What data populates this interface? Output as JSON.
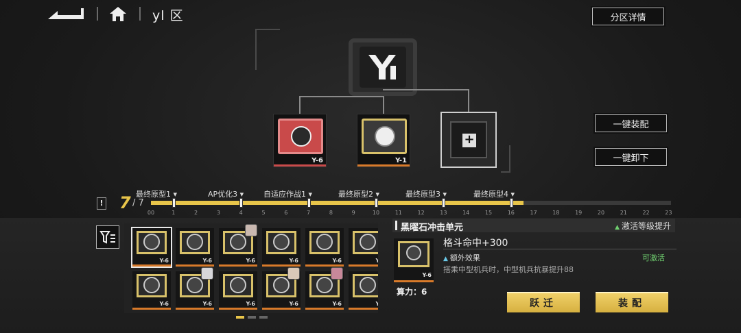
{
  "header": {
    "zone_title": "yl 区",
    "zone_detail_label": "分区详情"
  },
  "hub": {
    "logo_icon": "yl-logo-icon"
  },
  "slots": [
    {
      "label": "Y-6",
      "accent": "#c94a4a"
    },
    {
      "label": "Y-1",
      "accent": "#d8c16a"
    },
    {
      "label": "",
      "empty": true
    }
  ],
  "actions": {
    "equip_all": "一键装配",
    "unequip_all": "一键卸下"
  },
  "timeline": {
    "level": "7",
    "max": "/ 7",
    "milestones": [
      "最终原型1",
      "AP优化3",
      "自适应作战1",
      "最终原型2",
      "最终原型3",
      "最终原型4"
    ],
    "ticks": [
      "00",
      "1",
      "2",
      "3",
      "4",
      "5",
      "6",
      "7",
      "8",
      "9",
      "10",
      "11",
      "12",
      "13",
      "14",
      "15",
      "16",
      "17",
      "18",
      "19",
      "20",
      "21",
      "22",
      "23"
    ],
    "progress": 0.717
  },
  "inventory": {
    "items": [
      {
        "label": "Y-6",
        "sym": "x"
      },
      {
        "label": "Y-6",
        "sym": "x"
      },
      {
        "label": "Y-6",
        "sym": "swirl"
      },
      {
        "label": "Y-6",
        "sym": "x"
      },
      {
        "label": "Y-6",
        "sym": "swirl"
      },
      {
        "label": "Y-6",
        "sym": "x"
      },
      {
        "label": "Y-6",
        "sym": "x"
      },
      {
        "label": "Y-6",
        "sym": "x"
      },
      {
        "label": "Y-6",
        "sym": "swirl"
      },
      {
        "label": "Y-6",
        "sym": "x"
      },
      {
        "label": "Y-6",
        "sym": "swirl"
      },
      {
        "label": "Y-6",
        "sym": "x"
      }
    ]
  },
  "detail": {
    "title": "黑曜石冲击单元",
    "upgrade": "激活等级提升",
    "stat": "格斗命中+300",
    "extra_label": "额外效果",
    "extra_state": "可激活",
    "desc": "搭乘中型机兵时，中型机兵抗暴提升88",
    "power": "算力：6",
    "label": "Y-6",
    "btn_transfer": "跃迁",
    "btn_equip": "装配"
  }
}
